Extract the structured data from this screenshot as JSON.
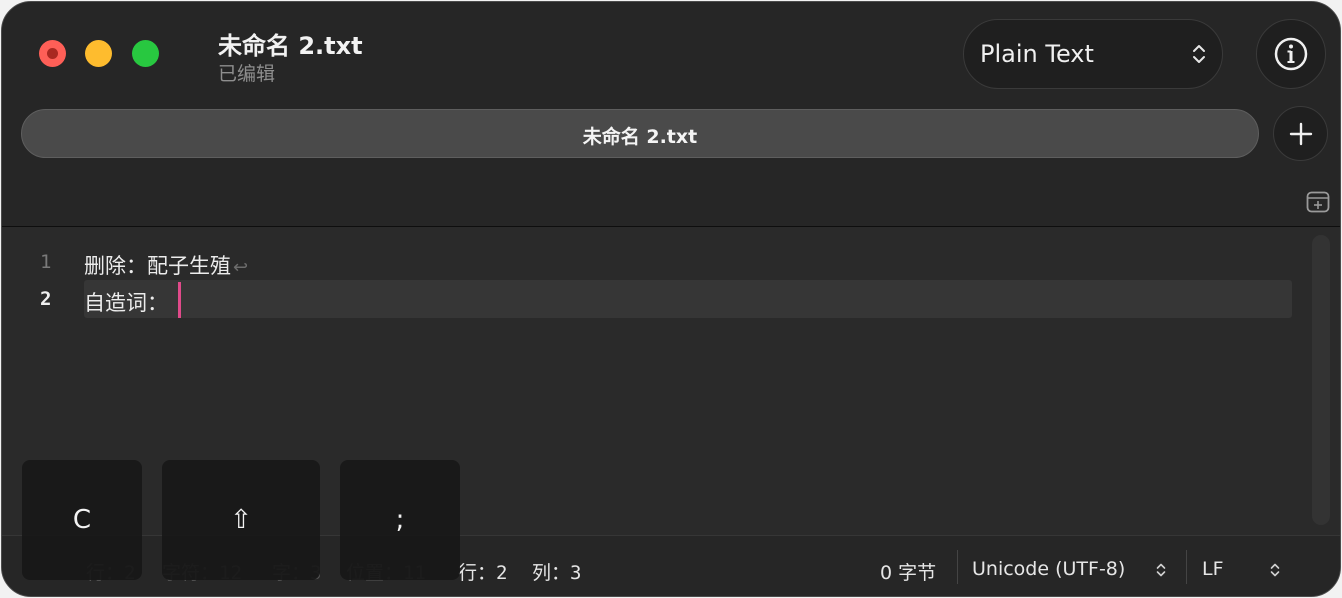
{
  "window": {
    "title": "未命名 2.txt",
    "status": "已编辑"
  },
  "toolbar": {
    "syntax_mode": "Plain Text",
    "info_icon": "info-circle-icon"
  },
  "tabs": [
    {
      "label": "未命名 2.txt",
      "active": true
    }
  ],
  "editor": {
    "lines": [
      {
        "number": "1",
        "text": "删除：配子生殖",
        "return_mark": "↩"
      },
      {
        "number": "2",
        "text": "自造词："
      }
    ],
    "current_line": 2,
    "caret_color": "#e04a8a"
  },
  "status_bar": {
    "line_count_label": "行：",
    "line_count": "2",
    "char_label": "字符：",
    "char_count": "12",
    "word_label": "字：",
    "word_count": "3",
    "position_label": "位置：",
    "position": "11",
    "row_label": "行：",
    "row": "2",
    "col_label": "列：",
    "col": "3",
    "bytes": "0 字节",
    "encoding": "Unicode (UTF-8)",
    "line_ending": "LF"
  },
  "key_overlay": [
    {
      "key": "C"
    },
    {
      "key": "⇧"
    },
    {
      "key": ";"
    }
  ],
  "colors": {
    "window_bg": "#2a2a2a",
    "close": "#fe5f57",
    "minimize": "#febc2e",
    "maximize": "#28c840"
  }
}
